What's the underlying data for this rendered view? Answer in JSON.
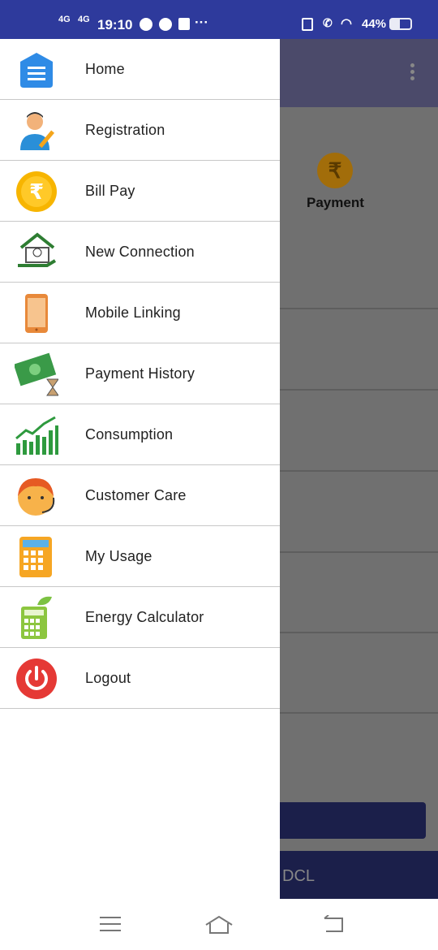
{
  "status_bar": {
    "network1": "4G",
    "network2": "4G",
    "time": "19:10",
    "more": "···",
    "battery": "44%"
  },
  "background": {
    "payment_label": "Payment",
    "rupee": "₹",
    "footer_text": "DCL"
  },
  "menu": [
    {
      "label": "Home",
      "icon": "home-icon"
    },
    {
      "label": "Registration",
      "icon": "registration-icon"
    },
    {
      "label": "Bill Pay",
      "icon": "rupee-icon"
    },
    {
      "label": "New Connection",
      "icon": "new-connection-icon"
    },
    {
      "label": "Mobile Linking",
      "icon": "mobile-icon"
    },
    {
      "label": "Payment History",
      "icon": "payment-history-icon"
    },
    {
      "label": "Consumption",
      "icon": "chart-icon"
    },
    {
      "label": "Customer Care",
      "icon": "customer-care-icon"
    },
    {
      "label": "My Usage",
      "icon": "calculator-icon"
    },
    {
      "label": "Energy Calculator",
      "icon": "energy-calculator-icon"
    },
    {
      "label": "Logout",
      "icon": "power-icon"
    }
  ],
  "colors": {
    "status_bar": "#2e3a9c",
    "overlay": "#707070",
    "footer": "#1b1f4a"
  }
}
